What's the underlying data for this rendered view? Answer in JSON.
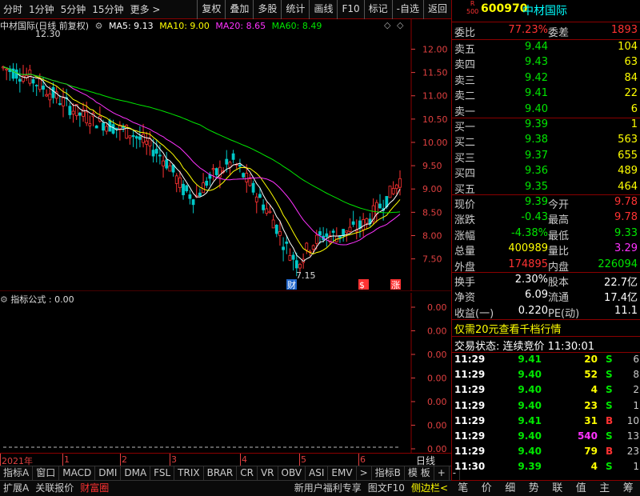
{
  "toolbar": {
    "left_items": [
      "分时",
      "1分钟",
      "5分钟",
      "15分钟",
      "更多 >"
    ],
    "right_items": [
      "复权",
      "叠加",
      "多股",
      "统计",
      "画线",
      "F10",
      "标记",
      "-自选",
      "返回"
    ]
  },
  "chart_header": {
    "title": "中材国际(日线 前复权)",
    "ma5": "MA5: 9.13",
    "ma10": "MA10: 9.00",
    "ma20": "MA20: 8.65",
    "ma60": "MA60: 8.49"
  },
  "chart_data": {
    "type": "candlestick",
    "y_ticks": [
      "12.00",
      "11.50",
      "11.00",
      "10.50",
      "10.00",
      "9.50",
      "9.00",
      "8.50",
      "8.00",
      "7.50"
    ],
    "ylim": [
      7.15,
      12.3
    ],
    "high_label": "12.30",
    "low_label": "7.15",
    "x_labels": [
      "2021年",
      "1",
      "2",
      "3",
      "4",
      "5",
      "6"
    ],
    "colors": {
      "up": "#ff3232",
      "down": "#00c8c8",
      "ma5": "#ffffff",
      "ma10": "#ffff00",
      "ma20": "#ff32ff",
      "ma60": "#00e600"
    },
    "markers": [
      "财",
      "$",
      "涨"
    ]
  },
  "sub_chart": {
    "title": "指标公式 : 0.00",
    "y_ticks": [
      "0.00",
      "0.00",
      "0.00",
      "0.00",
      "0.00",
      "0.00",
      "0.00"
    ]
  },
  "period_label": "日线",
  "bottom_tabs": [
    "指标A",
    "窗口",
    "MACD",
    "DMI",
    "DMA",
    "FSL",
    "TRIX",
    "BRAR",
    "CR",
    "VR",
    "OBV",
    "ASI",
    "EMV",
    ">",
    "指标B",
    "模 板",
    "+",
    "-"
  ],
  "bottom_tabs2": [
    "扩展A",
    "关联报价",
    "财富圈"
  ],
  "bottom_tabs2_right": [
    "新用户福利专享",
    "图文F10",
    "侧边栏<"
  ],
  "quote": {
    "badge_top": "R",
    "badge_bottom": "500",
    "code": "600970",
    "name": "中材国际",
    "wei_bi_label": "委比",
    "wei_bi": "77.23%",
    "wei_cha_label": "委差",
    "wei_cha": "1893",
    "asks": [
      {
        "label": "卖五",
        "price": "9.44",
        "vol": "104"
      },
      {
        "label": "卖四",
        "price": "9.43",
        "vol": "63"
      },
      {
        "label": "卖三",
        "price": "9.42",
        "vol": "84"
      },
      {
        "label": "卖二",
        "price": "9.41",
        "vol": "22"
      },
      {
        "label": "卖一",
        "price": "9.40",
        "vol": "6"
      }
    ],
    "bids": [
      {
        "label": "买一",
        "price": "9.39",
        "vol": "1"
      },
      {
        "label": "买二",
        "price": "9.38",
        "vol": "563"
      },
      {
        "label": "买三",
        "price": "9.37",
        "vol": "655"
      },
      {
        "label": "买四",
        "price": "9.36",
        "vol": "489"
      },
      {
        "label": "买五",
        "price": "9.35",
        "vol": "464"
      }
    ],
    "stats": [
      {
        "l1": "现价",
        "v1": "9.39",
        "c1": "green",
        "l2": "今开",
        "v2": "9.78",
        "c2": "red"
      },
      {
        "l1": "涨跌",
        "v1": "-0.43",
        "c1": "green",
        "l2": "最高",
        "v2": "9.78",
        "c2": "red"
      },
      {
        "l1": "涨幅",
        "v1": "-4.38%",
        "c1": "green",
        "l2": "最低",
        "v2": "9.33",
        "c2": "green"
      },
      {
        "l1": "总量",
        "v1": "400989",
        "c1": "yellow",
        "l2": "量比",
        "v2": "3.29",
        "c2": "magenta"
      },
      {
        "l1": "外盘",
        "v1": "174895",
        "c1": "red",
        "l2": "内盘",
        "v2": "226094",
        "c2": "green"
      }
    ],
    "stats2": [
      {
        "l1": "换手",
        "v1": "2.30%",
        "l2": "股本",
        "v2": "22.7亿"
      },
      {
        "l1": "净资",
        "v1": "6.09",
        "l2": "流通",
        "v2": "17.4亿"
      },
      {
        "l1": "收益(一)",
        "v1": "0.220",
        "l2": "PE(动)",
        "v2": "11.1"
      }
    ],
    "promo": "仅需20元查看千档行情",
    "status": "交易状态: 连续竞价 11:30:01",
    "ticks": [
      {
        "time": "11:29",
        "price": "9.41",
        "pc": "green",
        "vol": "20",
        "vc": "yellow",
        "side": "S",
        "sc": "green",
        "n": "6"
      },
      {
        "time": "11:29",
        "price": "9.40",
        "pc": "green",
        "vol": "52",
        "vc": "yellow",
        "side": "S",
        "sc": "green",
        "n": "8"
      },
      {
        "time": "11:29",
        "price": "9.40",
        "pc": "green",
        "vol": "4",
        "vc": "yellow",
        "side": "S",
        "sc": "green",
        "n": "2"
      },
      {
        "time": "11:29",
        "price": "9.40",
        "pc": "green",
        "vol": "23",
        "vc": "yellow",
        "side": "S",
        "sc": "green",
        "n": "1"
      },
      {
        "time": "11:29",
        "price": "9.41",
        "pc": "green",
        "vol": "31",
        "vc": "yellow",
        "side": "B",
        "sc": "red",
        "n": "10"
      },
      {
        "time": "11:29",
        "price": "9.40",
        "pc": "green",
        "vol": "540",
        "vc": "magenta",
        "side": "S",
        "sc": "green",
        "n": "13"
      },
      {
        "time": "11:29",
        "price": "9.40",
        "pc": "green",
        "vol": "79",
        "vc": "yellow",
        "side": "B",
        "sc": "red",
        "n": "23"
      },
      {
        "time": "11:30",
        "price": "9.39",
        "pc": "green",
        "vol": "4",
        "vc": "yellow",
        "side": "S",
        "sc": "green",
        "n": "1"
      }
    ],
    "footer": [
      "笔",
      "价",
      "细",
      "势",
      "联",
      "值",
      "主",
      "筹"
    ]
  }
}
